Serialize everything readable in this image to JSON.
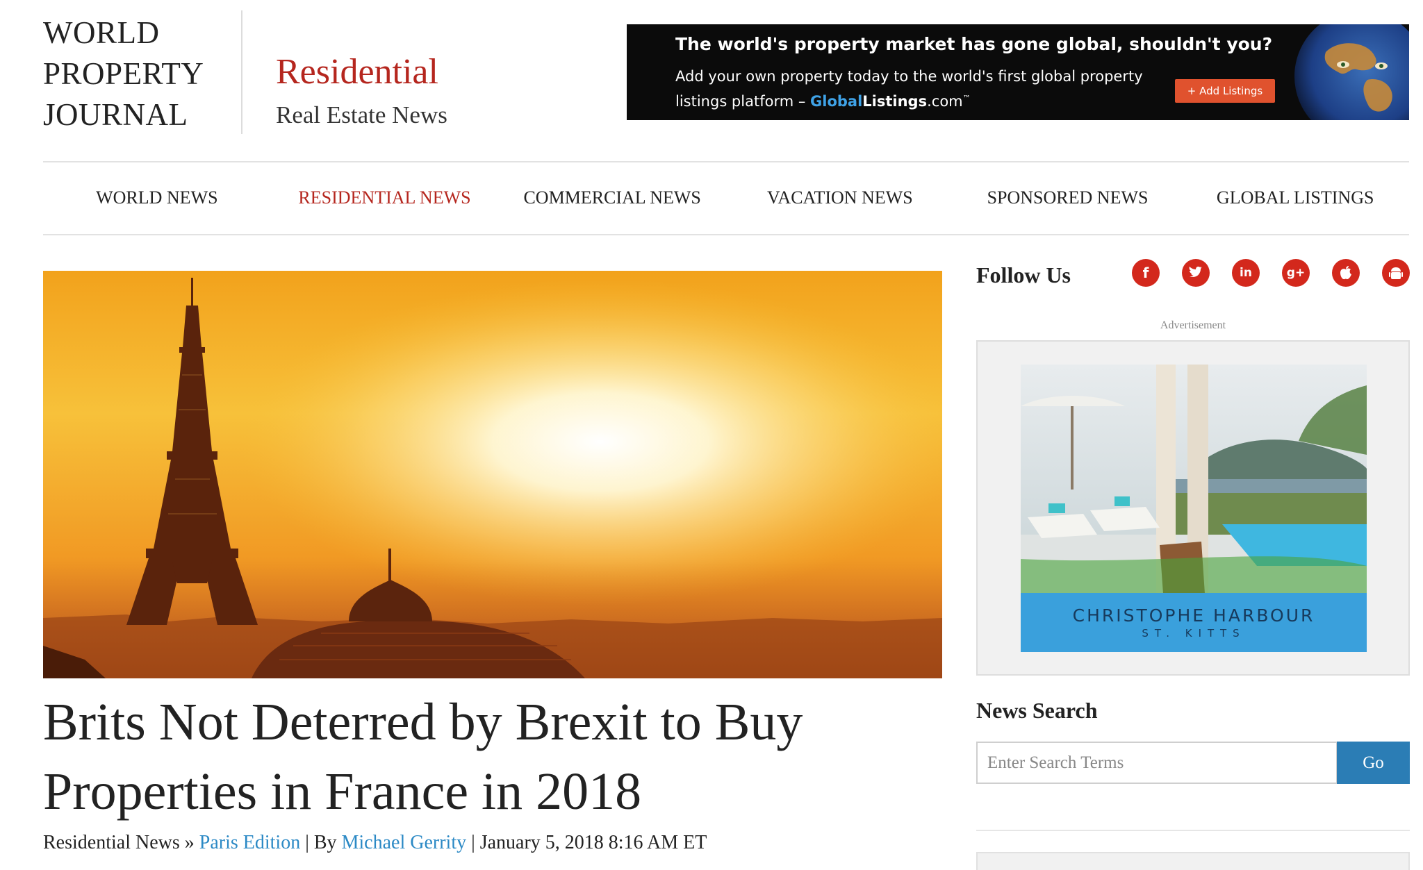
{
  "header": {
    "logo_lines": [
      "WORLD",
      "PROPERTY",
      "JOURNAL"
    ],
    "section_title": "Residential",
    "section_subtitle": "Real Estate News"
  },
  "banner_ad": {
    "headline": "The world's property market has gone global, shouldn't you?",
    "body_line1": "Add your own property today to the world's first global property",
    "body_line2_prefix": "listings platform – ",
    "brand_global": "Global",
    "brand_listings": "Listings",
    "brand_tld": ".com",
    "brand_tm": "™",
    "button_label": "+ Add Listings"
  },
  "nav": {
    "items": [
      {
        "label": "WORLD NEWS",
        "active": false
      },
      {
        "label": "RESIDENTIAL NEWS",
        "active": true
      },
      {
        "label": "COMMERCIAL NEWS",
        "active": false
      },
      {
        "label": "VACATION NEWS",
        "active": false
      },
      {
        "label": "SPONSORED NEWS",
        "active": false
      },
      {
        "label": "GLOBAL LISTINGS",
        "active": false
      }
    ]
  },
  "article": {
    "headline": "Brits Not Deterred by Brexit to Buy Properties in France in 2018",
    "category": "Residential News",
    "separator": "»",
    "edition": "Paris Edition",
    "by_prefix": "By",
    "author": "Michael Gerrity",
    "date": "January 5, 2018 8:16 AM ET"
  },
  "sidebar": {
    "follow_title": "Follow Us",
    "social_icons": [
      {
        "name": "facebook-icon",
        "glyph": "f"
      },
      {
        "name": "twitter-icon",
        "glyph": "t"
      },
      {
        "name": "linkedin-icon",
        "glyph": "in"
      },
      {
        "name": "google-plus-icon",
        "glyph": "g+"
      },
      {
        "name": "apple-icon",
        "glyph": ""
      },
      {
        "name": "android-icon",
        "glyph": ""
      }
    ],
    "ad_label": "Advertisement",
    "ad_brand": "CHRISTOPHE HARBOUR",
    "ad_brand_sub": "ST. KITTS",
    "search_title": "News Search",
    "search_placeholder": "Enter Search Terms",
    "search_value": "",
    "search_button": "Go"
  },
  "colors": {
    "accent_red": "#b5261e",
    "link_blue": "#2b89c5",
    "button_blue": "#2b7db5",
    "social_red": "#d3281c"
  }
}
